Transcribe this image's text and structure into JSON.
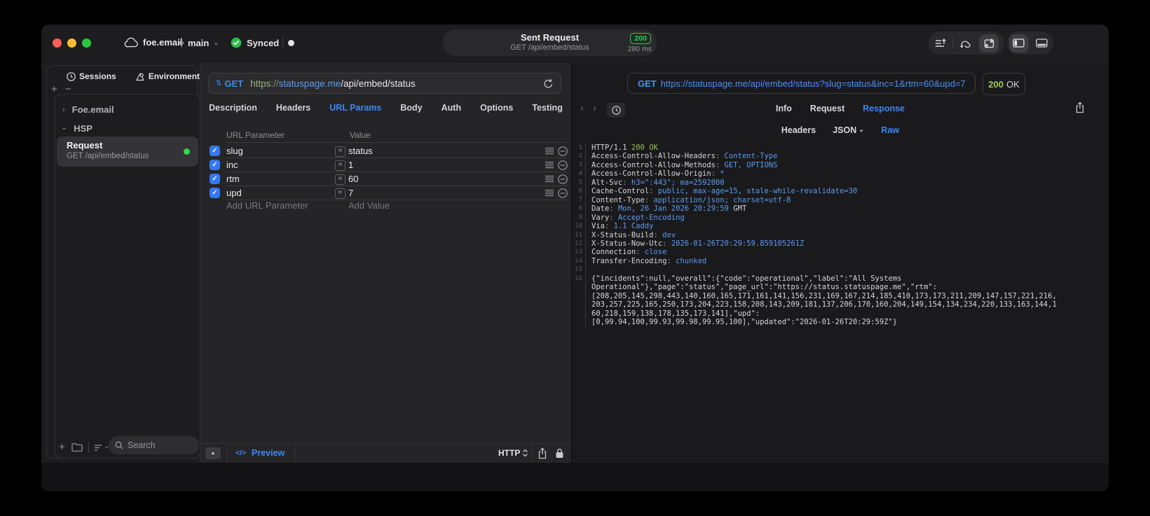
{
  "titlebar": {
    "project": "foe.email",
    "branch": "main",
    "sync_status": "Synced",
    "sent_pill": {
      "title": "Sent Request",
      "subtitle": "GET /api/embed/status",
      "status_code": "200",
      "duration": "280 ms"
    }
  },
  "glyphs": {
    "updown": "⇅",
    "chevron_down": "⌄",
    "chevron_right": "›",
    "chevron_left": "‹",
    "chevron_right2": "›",
    "plus": "+",
    "minus": "−",
    "check": "✓",
    "dot": "●",
    "up_triangle": "▲",
    "code_tag": "</>",
    "eq": "=",
    "proto_updown": "⇕"
  },
  "sidebar": {
    "tabs": [
      {
        "label": "Sessions",
        "icon": "clock-icon"
      },
      {
        "label": "Environments",
        "icon": "environments-icon"
      }
    ],
    "tree": [
      {
        "label": "Foe.email",
        "state": "collapsed"
      },
      {
        "label": "HSP",
        "state": "expanded"
      }
    ],
    "request_item": {
      "title": "Request",
      "subtitle": "GET /api/embed/status"
    },
    "search_placeholder": "Search"
  },
  "request_panel": {
    "method": "GET",
    "url": {
      "scheme": "https",
      "sep": "://",
      "host": "statuspage.me",
      "path": "/api/embed/status"
    },
    "tabs": [
      "Description",
      "Headers",
      "URL Params",
      "Body",
      "Auth",
      "Options",
      "Testing"
    ],
    "active_tab": "URL Params",
    "table": {
      "columns": [
        "URL Parameter",
        "Value"
      ],
      "rows": [
        {
          "name": "slug",
          "value": "status",
          "checked": true
        },
        {
          "name": "inc",
          "value": "1",
          "checked": true
        },
        {
          "name": "rtm",
          "value": "60",
          "checked": true
        },
        {
          "name": "upd",
          "value": "7",
          "checked": true
        }
      ],
      "add_param_placeholder": "Add URL Parameter",
      "add_value_placeholder": "Add Value"
    },
    "footer": {
      "preview_label": "Preview",
      "protocol": "HTTP"
    }
  },
  "response_panel": {
    "request_line": "https://statuspage.me/api/embed/status?slug=status&inc=1&rtm=60&upd=7",
    "request_method": "GET",
    "status": {
      "code": "200",
      "text": "OK"
    },
    "tabs": [
      "Info",
      "Request",
      "Response"
    ],
    "active_tab": "Response",
    "subtabs": [
      "Headers",
      "JSON",
      "Raw"
    ],
    "active_subtab": "Raw",
    "dropdown_subtab": "JSON",
    "lines": [
      {
        "num": "1",
        "segments": [
          {
            "text": "HTTP/1.1 ",
            "color": "plain"
          },
          {
            "text": "200 OK",
            "color": "green"
          }
        ]
      },
      {
        "num": "2",
        "segments": [
          {
            "text": "Access-Control-Allow-Headers",
            "color": "plain"
          },
          {
            "text": ": ",
            "color": "punct"
          },
          {
            "text": "Content-Type",
            "color": "blue"
          }
        ]
      },
      {
        "num": "3",
        "segments": [
          {
            "text": "Access-Control-Allow-Methods",
            "color": "plain"
          },
          {
            "text": ": ",
            "color": "punct"
          },
          {
            "text": "GET, OPTIONS",
            "color": "blue"
          }
        ]
      },
      {
        "num": "4",
        "segments": [
          {
            "text": "Access-Control-Allow-Origin",
            "color": "plain"
          },
          {
            "text": ": ",
            "color": "punct"
          },
          {
            "text": "*",
            "color": "blue"
          }
        ]
      },
      {
        "num": "5",
        "segments": [
          {
            "text": "Alt-Svc",
            "color": "plain"
          },
          {
            "text": ": ",
            "color": "punct"
          },
          {
            "text": "h3=\":443\"; ma=2592000",
            "color": "blue"
          }
        ]
      },
      {
        "num": "6",
        "segments": [
          {
            "text": "Cache-Control",
            "color": "plain"
          },
          {
            "text": ": ",
            "color": "punct"
          },
          {
            "text": "public, max-age=15, stale-while-revalidate=30",
            "color": "blue"
          }
        ]
      },
      {
        "num": "7",
        "segments": [
          {
            "text": "Content-Type",
            "color": "plain"
          },
          {
            "text": ": ",
            "color": "punct"
          },
          {
            "text": "application/json; charset=utf-8",
            "color": "blue"
          }
        ]
      },
      {
        "num": "8",
        "segments": [
          {
            "text": "Date",
            "color": "plain"
          },
          {
            "text": ": ",
            "color": "punct"
          },
          {
            "text": "Mon, 26 Jan 2026 20:29:59 ",
            "color": "blue"
          },
          {
            "text": "GMT",
            "color": "plain"
          }
        ]
      },
      {
        "num": "9",
        "segments": [
          {
            "text": "Vary",
            "color": "plain"
          },
          {
            "text": ": ",
            "color": "punct"
          },
          {
            "text": "Accept-Encoding",
            "color": "blue"
          }
        ]
      },
      {
        "num": "10",
        "segments": [
          {
            "text": "Via",
            "color": "plain"
          },
          {
            "text": ": ",
            "color": "punct"
          },
          {
            "text": "1.1 Caddy",
            "color": "blue"
          }
        ]
      },
      {
        "num": "11",
        "segments": [
          {
            "text": "X-Status-Build",
            "color": "plain"
          },
          {
            "text": ": ",
            "color": "punct"
          },
          {
            "text": "dev",
            "color": "blue"
          }
        ]
      },
      {
        "num": "12",
        "segments": [
          {
            "text": "X-Status-Now-Utc",
            "color": "plain"
          },
          {
            "text": ": ",
            "color": "punct"
          },
          {
            "text": "2026-01-26T20:29:59.859105261Z",
            "color": "blue"
          }
        ]
      },
      {
        "num": "13",
        "segments": [
          {
            "text": "Connection",
            "color": "plain"
          },
          {
            "text": ": ",
            "color": "punct"
          },
          {
            "text": "close",
            "color": "blue"
          }
        ]
      },
      {
        "num": "14",
        "segments": [
          {
            "text": "Transfer-Encoding",
            "color": "plain"
          },
          {
            "text": ": ",
            "color": "punct"
          },
          {
            "text": "chunked",
            "color": "blue"
          }
        ]
      },
      {
        "num": "15",
        "segments": []
      },
      {
        "num": "16",
        "segments": [
          {
            "text": "{\"incidents\":null,\"overall\":{\"code\":\"operational\",\"label\":\"All Systems",
            "color": "plain"
          }
        ]
      },
      {
        "num": "",
        "segments": [
          {
            "text": "Operational\"},\"page\":\"status\",\"page_url\":\"https://status.statuspage.me\",\"rtm\":",
            "color": "plain"
          }
        ]
      },
      {
        "num": "",
        "segments": [
          {
            "text": "[208,205,145,298,443,140,160,165,171,161,141,156,231,169,167,214,185,410,173,173,211,209,147,157,221,216,",
            "color": "plain"
          }
        ]
      },
      {
        "num": "",
        "segments": [
          {
            "text": "203,257,225,165,250,173,204,223,158,208,143,209,181,137,206,170,160,204,149,154,134,234,220,133,163,144,1",
            "color": "plain"
          }
        ]
      },
      {
        "num": "",
        "segments": [
          {
            "text": "60,218,159,138,178,135,173,141],\"upd\":",
            "color": "plain"
          }
        ]
      },
      {
        "num": "",
        "segments": [
          {
            "text": "[0,99.94,100,99.93,99.98,99.95,100],\"updated\":\"2026-01-26T20:29:59Z\"}",
            "color": "plain"
          }
        ]
      }
    ]
  },
  "colors": {
    "accent_blue": "#3e86f7",
    "success_green": "#32d74b",
    "code_green": "#8fc24e",
    "code_blue": "#5b9bf1"
  }
}
